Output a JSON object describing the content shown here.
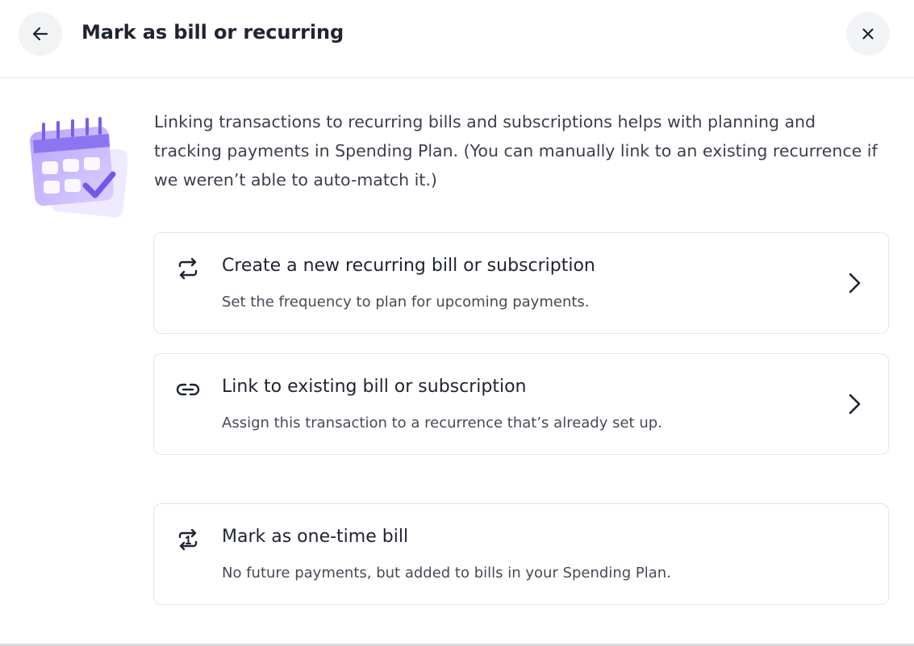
{
  "header": {
    "title": "Mark as bill or recurring",
    "back_icon": "arrow-left-icon",
    "close_icon": "close-icon"
  },
  "intro": {
    "illustration": "calendar-check-illustration",
    "text": "Linking transactions to recurring bills and subscriptions helps with planning and tracking payments in Spending Plan. (You can manually link to an existing recurrence if we weren’t able to auto-match it.)"
  },
  "options": [
    {
      "icon": "repeat-icon",
      "title": "Create a new recurring bill or subscription",
      "subtitle": "Set the frequency to plan for upcoming payments."
    },
    {
      "icon": "link-icon",
      "title": "Link to existing bill or subscription",
      "subtitle": "Assign this transaction to a recurrence that’s already set up."
    },
    {
      "icon": "repeat-once-icon",
      "title": "Mark as one-time bill",
      "subtitle": "No future payments, but added to bills in your Spending Plan."
    }
  ],
  "colors": {
    "accent_purple": "#8b6cf0",
    "text_primary": "#1f2430",
    "card_border": "#e3e5e9",
    "icon_button_bg": "#f2f3f5"
  }
}
